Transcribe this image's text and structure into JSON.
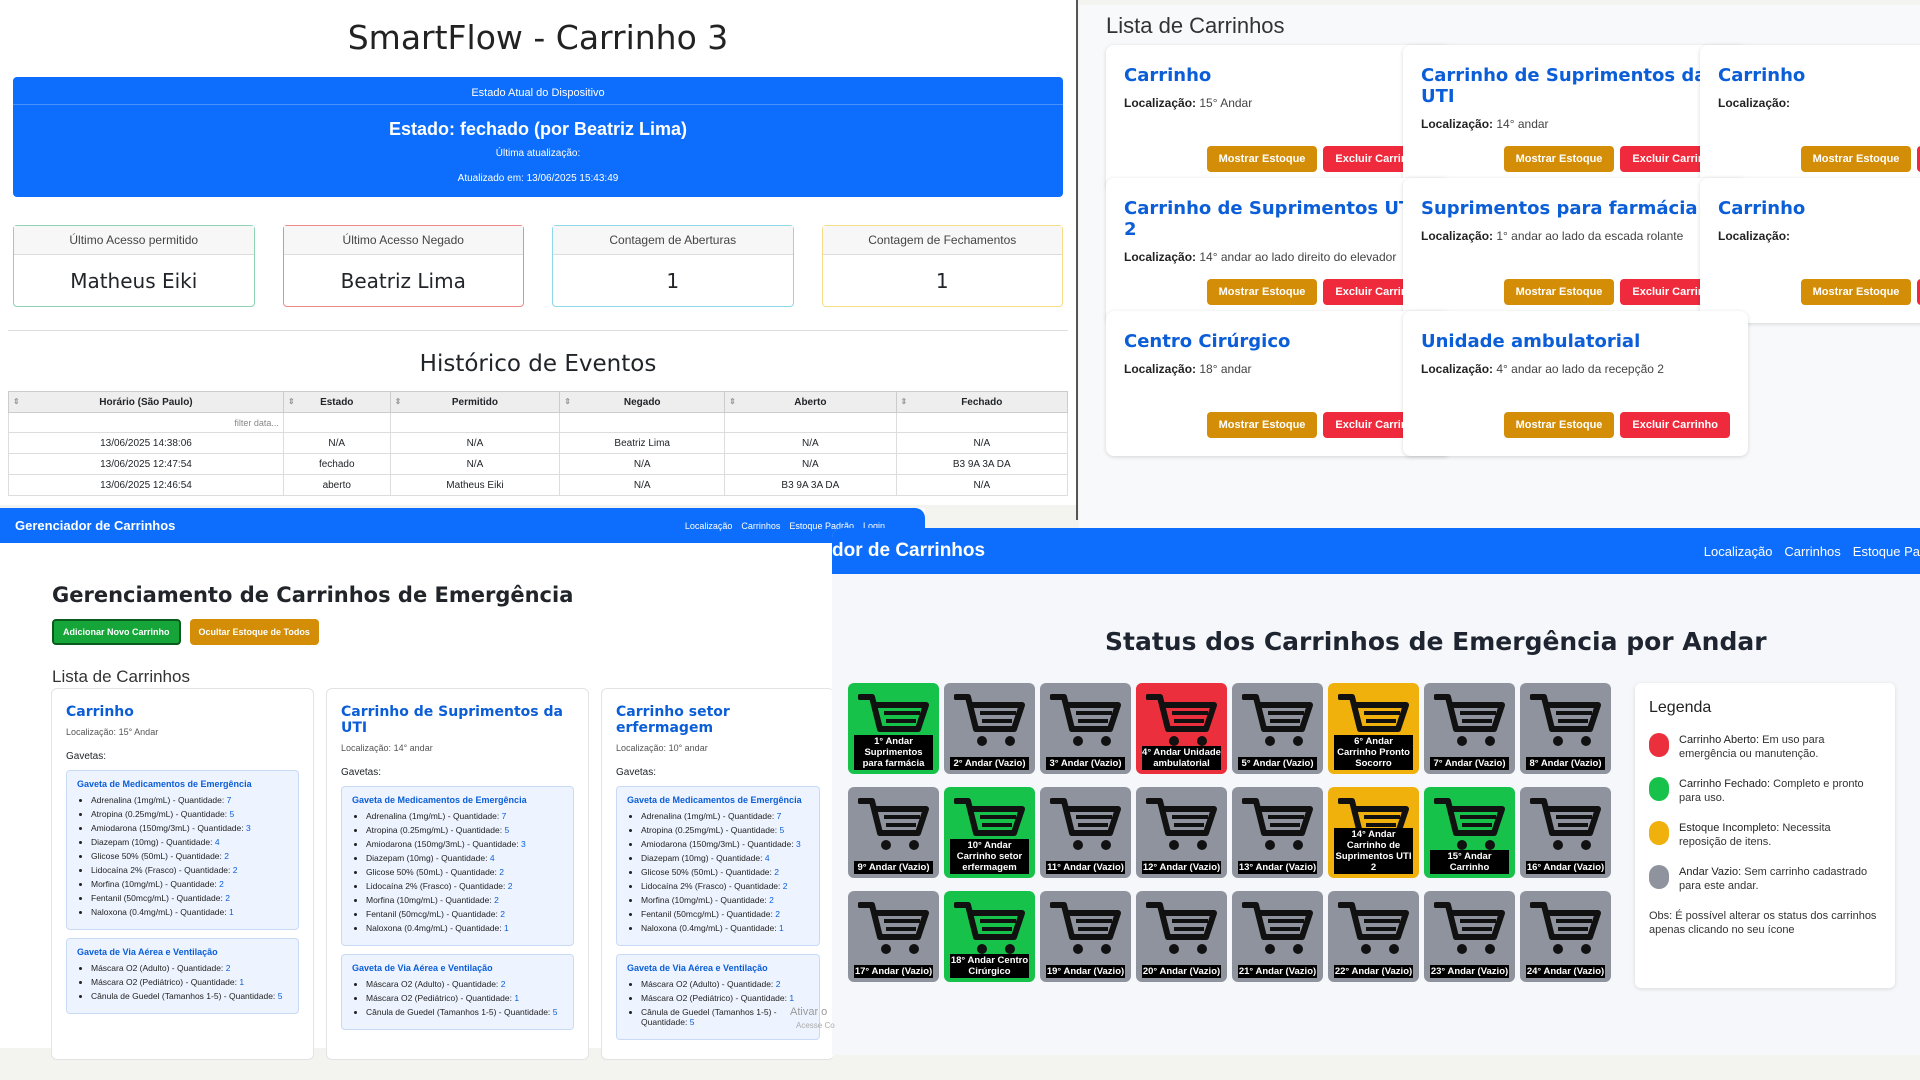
{
  "smartflow": {
    "title": "SmartFlow - Carrinho 3",
    "state_header": "Estado Atual do Dispositivo",
    "state": "Estado: fechado (por Beatriz Lima)",
    "last_update_label": "Última atualização:",
    "updated_at": "Atualizado em: 13/06/2025 15:43:49",
    "stats": [
      {
        "label": "Último Acesso permitido",
        "value": "Matheus Eiki",
        "color": "#8fd3b5"
      },
      {
        "label": "Último Acesso Negado",
        "value": "Beatriz Lima",
        "color": "#f08a8a"
      },
      {
        "label": "Contagem de Aberturas",
        "value": "1",
        "color": "#8fd8e8"
      },
      {
        "label": "Contagem de Fechamentos",
        "value": "1",
        "color": "#f6dd8a"
      }
    ],
    "history_title": "Histórico de Eventos",
    "columns": [
      "Horário (São Paulo)",
      "Estado",
      "Permitido",
      "Negado",
      "Aberto",
      "Fechado"
    ],
    "filter_placeholder": "filter data...",
    "rows": [
      [
        "13/06/2025 14:38:06",
        "N/A",
        "N/A",
        "Beatriz Lima",
        "N/A",
        "N/A"
      ],
      [
        "13/06/2025 12:47:54",
        "fechado",
        "N/A",
        "N/A",
        "N/A",
        "B3 9A 3A DA"
      ],
      [
        "13/06/2025 12:46:54",
        "aberto",
        "Matheus Eiki",
        "N/A",
        "B3 9A 3A DA",
        "N/A"
      ]
    ]
  },
  "lista": {
    "title": "Lista de Carrinhos",
    "loc_label": "Localização:",
    "show_btn": "Mostrar Estoque",
    "del_btn": "Excluir Carrinho",
    "cards": [
      {
        "name": "Carrinho",
        "loc": "15° Andar"
      },
      {
        "name": "Carrinho de Suprimentos da UTI",
        "loc": "14° andar"
      },
      {
        "name": "Carrinho",
        "loc": ""
      },
      {
        "name": "Carrinho de Suprimentos UTI 2",
        "loc": "14° andar ao lado direito do elevador"
      },
      {
        "name": "Suprimentos para farmácia",
        "loc": "1° andar ao lado da escada rolante"
      },
      {
        "name": "Carrinho",
        "loc": ""
      },
      {
        "name": "Centro Cirúrgico",
        "loc": "18° andar"
      },
      {
        "name": "Unidade ambulatorial",
        "loc": "4° andar ao lado da recepção 2"
      }
    ]
  },
  "gerenciador": {
    "brand": "Gerenciador de Carrinhos",
    "nav": [
      "Localização",
      "Carrinhos",
      "Estoque Padrão",
      "Login"
    ],
    "title": "Gerenciamento de Carrinhos de Emergência",
    "add_btn": "Adicionar Novo Carrinho",
    "hide_btn": "Ocultar Estoque de Todos",
    "list_title": "Lista de Carrinhos",
    "loc_label": "Localização:",
    "gavetas_label": "Gavetas:",
    "qty_label": "Quantidade:",
    "cards": [
      {
        "name": "Carrinho",
        "loc": "15° Andar"
      },
      {
        "name": "Carrinho de Suprimentos da UTI",
        "loc": "14° andar"
      },
      {
        "name": "Carrinho setor erfermagem",
        "loc": "10° andar"
      }
    ],
    "drawer1": {
      "title": "Gaveta de Medicamentos de Emergência",
      "items": [
        {
          "n": "Adrenalina (1mg/mL)",
          "q": "7"
        },
        {
          "n": "Atropina (0.25mg/mL)",
          "q": "5"
        },
        {
          "n": "Amiodarona (150mg/3mL)",
          "q": "3"
        },
        {
          "n": "Diazepam (10mg)",
          "q": "4"
        },
        {
          "n": "Glicose 50% (50mL)",
          "q": "2"
        },
        {
          "n": "Lidocaína 2% (Frasco)",
          "q": "2"
        },
        {
          "n": "Morfina (10mg/mL)",
          "q": "2"
        },
        {
          "n": "Fentanil (50mcg/mL)",
          "q": "2"
        },
        {
          "n": "Naloxona (0.4mg/mL)",
          "q": "1"
        }
      ]
    },
    "drawer2": {
      "title": "Gaveta de Via Aérea e Ventilação",
      "items": [
        {
          "n": "Máscara O2 (Adulto)",
          "q": "2"
        },
        {
          "n": "Máscara O2 (Pediátrico)",
          "q": "1"
        },
        {
          "n": "Cânula de Guedel (Tamanhos 1-5)",
          "q": "5"
        }
      ]
    },
    "watermark": "Ativar o",
    "watermark2": "Acesse Co"
  },
  "status": {
    "brand": "dor de Carrinhos",
    "nav": [
      "Localização",
      "Carrinhos",
      "Estoque Pa"
    ],
    "title": "Status dos Carrinhos de Emergência por Andar",
    "floors": [
      {
        "label": "1° Andar Suprimentos para farmácia",
        "status": "green"
      },
      {
        "label": "2° Andar (Vazio)",
        "status": "gray"
      },
      {
        "label": "3° Andar (Vazio)",
        "status": "gray"
      },
      {
        "label": "4° Andar Unidade ambulatorial",
        "status": "red"
      },
      {
        "label": "5° Andar (Vazio)",
        "status": "gray"
      },
      {
        "label": "6° Andar Carrinho Pronto Socorro",
        "status": "yellow"
      },
      {
        "label": "7° Andar (Vazio)",
        "status": "gray"
      },
      {
        "label": "8° Andar (Vazio)",
        "status": "gray"
      },
      {
        "label": "9° Andar (Vazio)",
        "status": "gray"
      },
      {
        "label": "10° Andar Carrinho setor erfermagem",
        "status": "green"
      },
      {
        "label": "11° Andar (Vazio)",
        "status": "gray"
      },
      {
        "label": "12° Andar (Vazio)",
        "status": "gray"
      },
      {
        "label": "13° Andar (Vazio)",
        "status": "gray"
      },
      {
        "label": "14° Andar Carrinho de Suprimentos UTI 2",
        "status": "yellow"
      },
      {
        "label": "15° Andar Carrinho",
        "status": "green"
      },
      {
        "label": "16° Andar (Vazio)",
        "status": "gray"
      },
      {
        "label": "17° Andar (Vazio)",
        "status": "gray"
      },
      {
        "label": "18° Andar Centro Cirúrgico",
        "status": "green"
      },
      {
        "label": "19° Andar (Vazio)",
        "status": "gray"
      },
      {
        "label": "20° Andar (Vazio)",
        "status": "gray"
      },
      {
        "label": "21° Andar (Vazio)",
        "status": "gray"
      },
      {
        "label": "22° Andar (Vazio)",
        "status": "gray"
      },
      {
        "label": "23° Andar (Vazio)",
        "status": "gray"
      },
      {
        "label": "24° Andar (Vazio)",
        "status": "gray"
      }
    ],
    "legend_title": "Legenda",
    "legend": [
      {
        "bold": "Carrinho Aberto:",
        "text": " Em uso para emergência ou manutenção.",
        "color": "#ec2f3c"
      },
      {
        "bold": "Carrinho Fechado:",
        "text": " Completo e pronto para uso.",
        "color": "#17c24a"
      },
      {
        "bold": "Estoque Incompleto:",
        "text": " Necessita reposição de itens.",
        "color": "#f0b10c"
      },
      {
        "bold": "Andar Vazio:",
        "text": " Sem carrinho cadastrado para este andar.",
        "color": "#8e939d"
      }
    ],
    "obs": "Obs: É possível alterar os status dos carrinhos apenas clicando no seu ícone"
  }
}
